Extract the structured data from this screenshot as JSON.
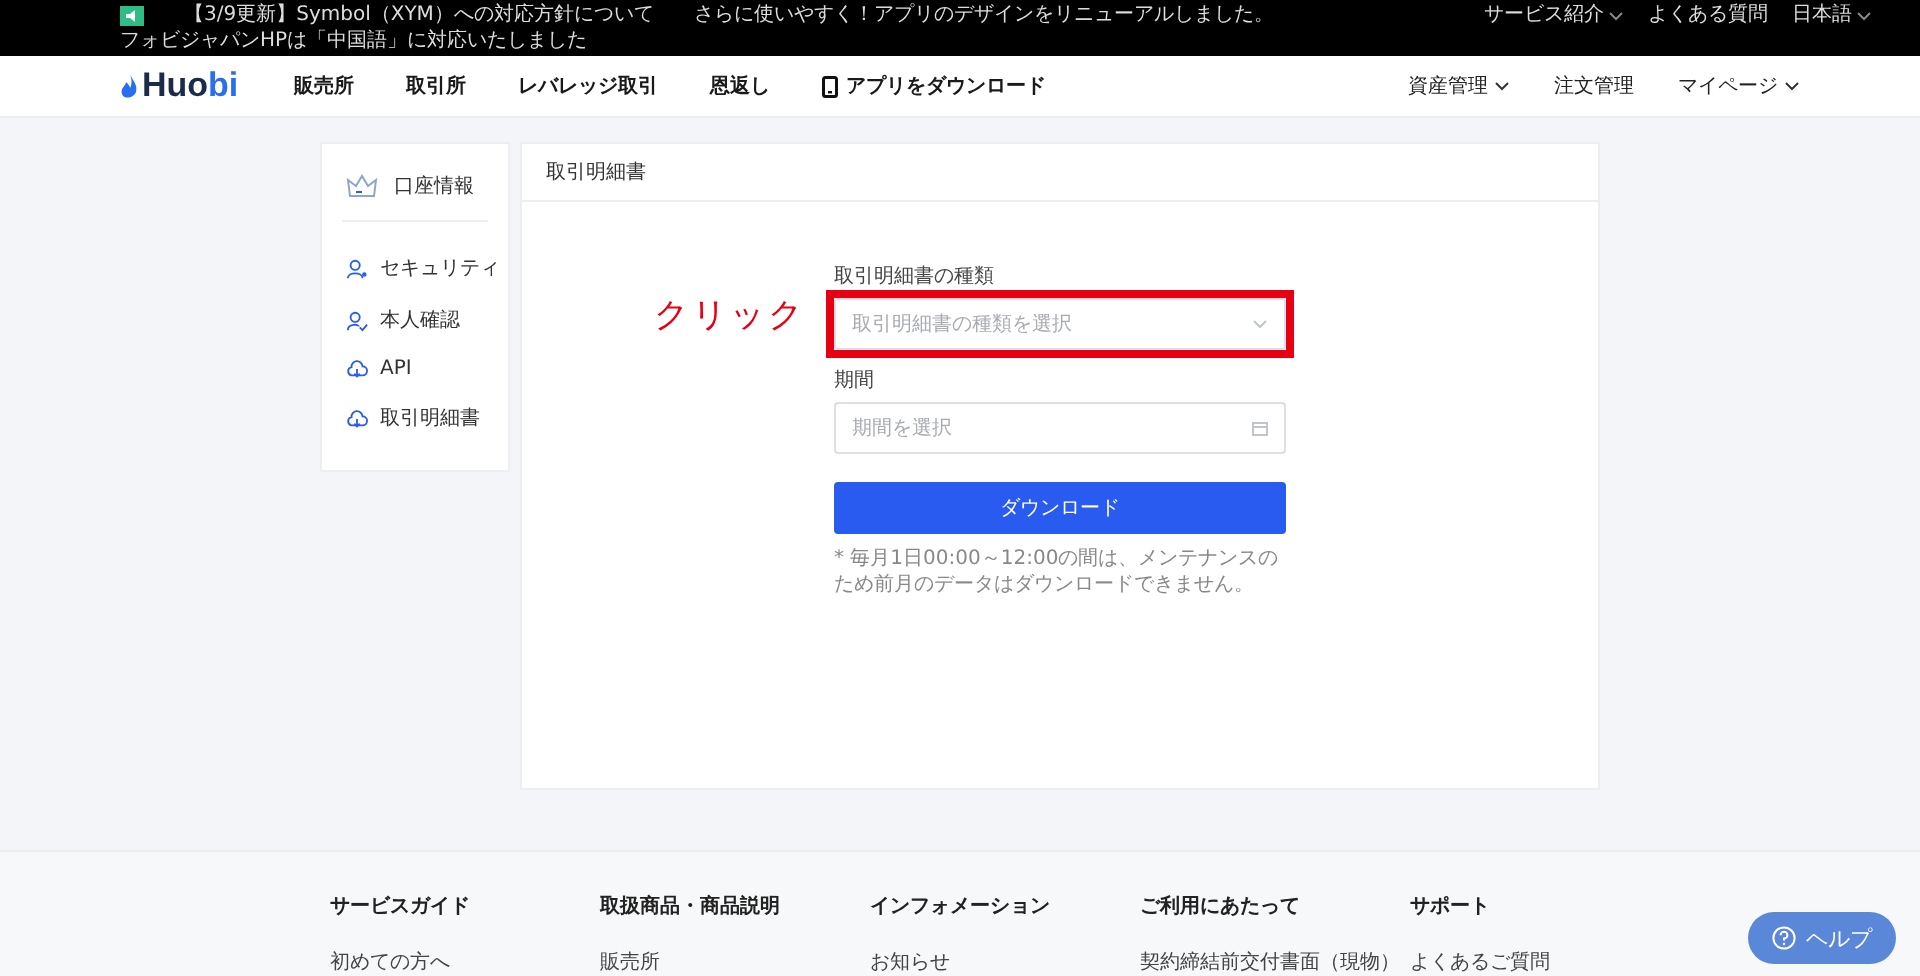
{
  "announcement_bar": {
    "items": [
      "【3/9更新】Symbol（XYM）への対応方針について",
      "さらに使いやすく！アプリのデザインをリニューアルしました。",
      "フォビジャパンHPは「中国語」に対応いたしました"
    ],
    "links": [
      {
        "label": "サービス紹介",
        "has_menu": true
      },
      {
        "label": "よくある質問",
        "has_menu": false
      },
      {
        "label": "日本語",
        "has_menu": true
      }
    ]
  },
  "nav": {
    "logo_parts": [
      "Huo",
      "bi"
    ],
    "items": [
      {
        "label": "販売所",
        "kind": "link"
      },
      {
        "label": "取引所",
        "kind": "link"
      },
      {
        "label": "レバレッジ取引",
        "kind": "link"
      },
      {
        "label": "恩返し",
        "kind": "link"
      },
      {
        "label": "アプリをダウンロード",
        "kind": "app"
      }
    ],
    "right": [
      {
        "label": "資産管理",
        "has_menu": true
      },
      {
        "label": "注文管理",
        "has_menu": false
      },
      {
        "label": "マイページ",
        "has_menu": true
      }
    ]
  },
  "sidebar": {
    "header": {
      "label": "口座情報"
    },
    "items": [
      {
        "label": "セキュリティ",
        "kind": "user",
        "selected": false
      },
      {
        "label": "本人確認",
        "kind": "verify",
        "selected": false
      },
      {
        "label": "API",
        "kind": "cloud",
        "selected": false
      },
      {
        "label": "取引明細書",
        "kind": "cloud",
        "selected": false
      }
    ]
  },
  "main": {
    "title": "取引明細書",
    "fields": [
      {
        "label": "取引明細書の種類",
        "placeholder": "取引明細書の種類を選択",
        "kind": "select",
        "highlighted": true
      },
      {
        "label": "期間",
        "placeholder": "期間を選択",
        "kind": "date",
        "highlighted": false
      }
    ],
    "button": "ダウンロード",
    "note": "* 毎月1日00:00～12:00の間は、メンテナンスのため前月のデータはダウンロードできません。",
    "annotation": "クリック"
  },
  "footer": {
    "columns": [
      {
        "heading": "サービスガイド",
        "links": [
          "初めての方へ"
        ]
      },
      {
        "heading": "取扱商品・商品説明",
        "links": [
          "販売所"
        ]
      },
      {
        "heading": "インフォメーション",
        "links": [
          "お知らせ"
        ]
      },
      {
        "heading": "ご利用にあたって",
        "links": [
          "契約締結前交付書面（現物）"
        ]
      },
      {
        "heading": "サポート",
        "links": [
          "よくあるご質問"
        ]
      }
    ]
  },
  "help_button": "ヘルプ"
}
